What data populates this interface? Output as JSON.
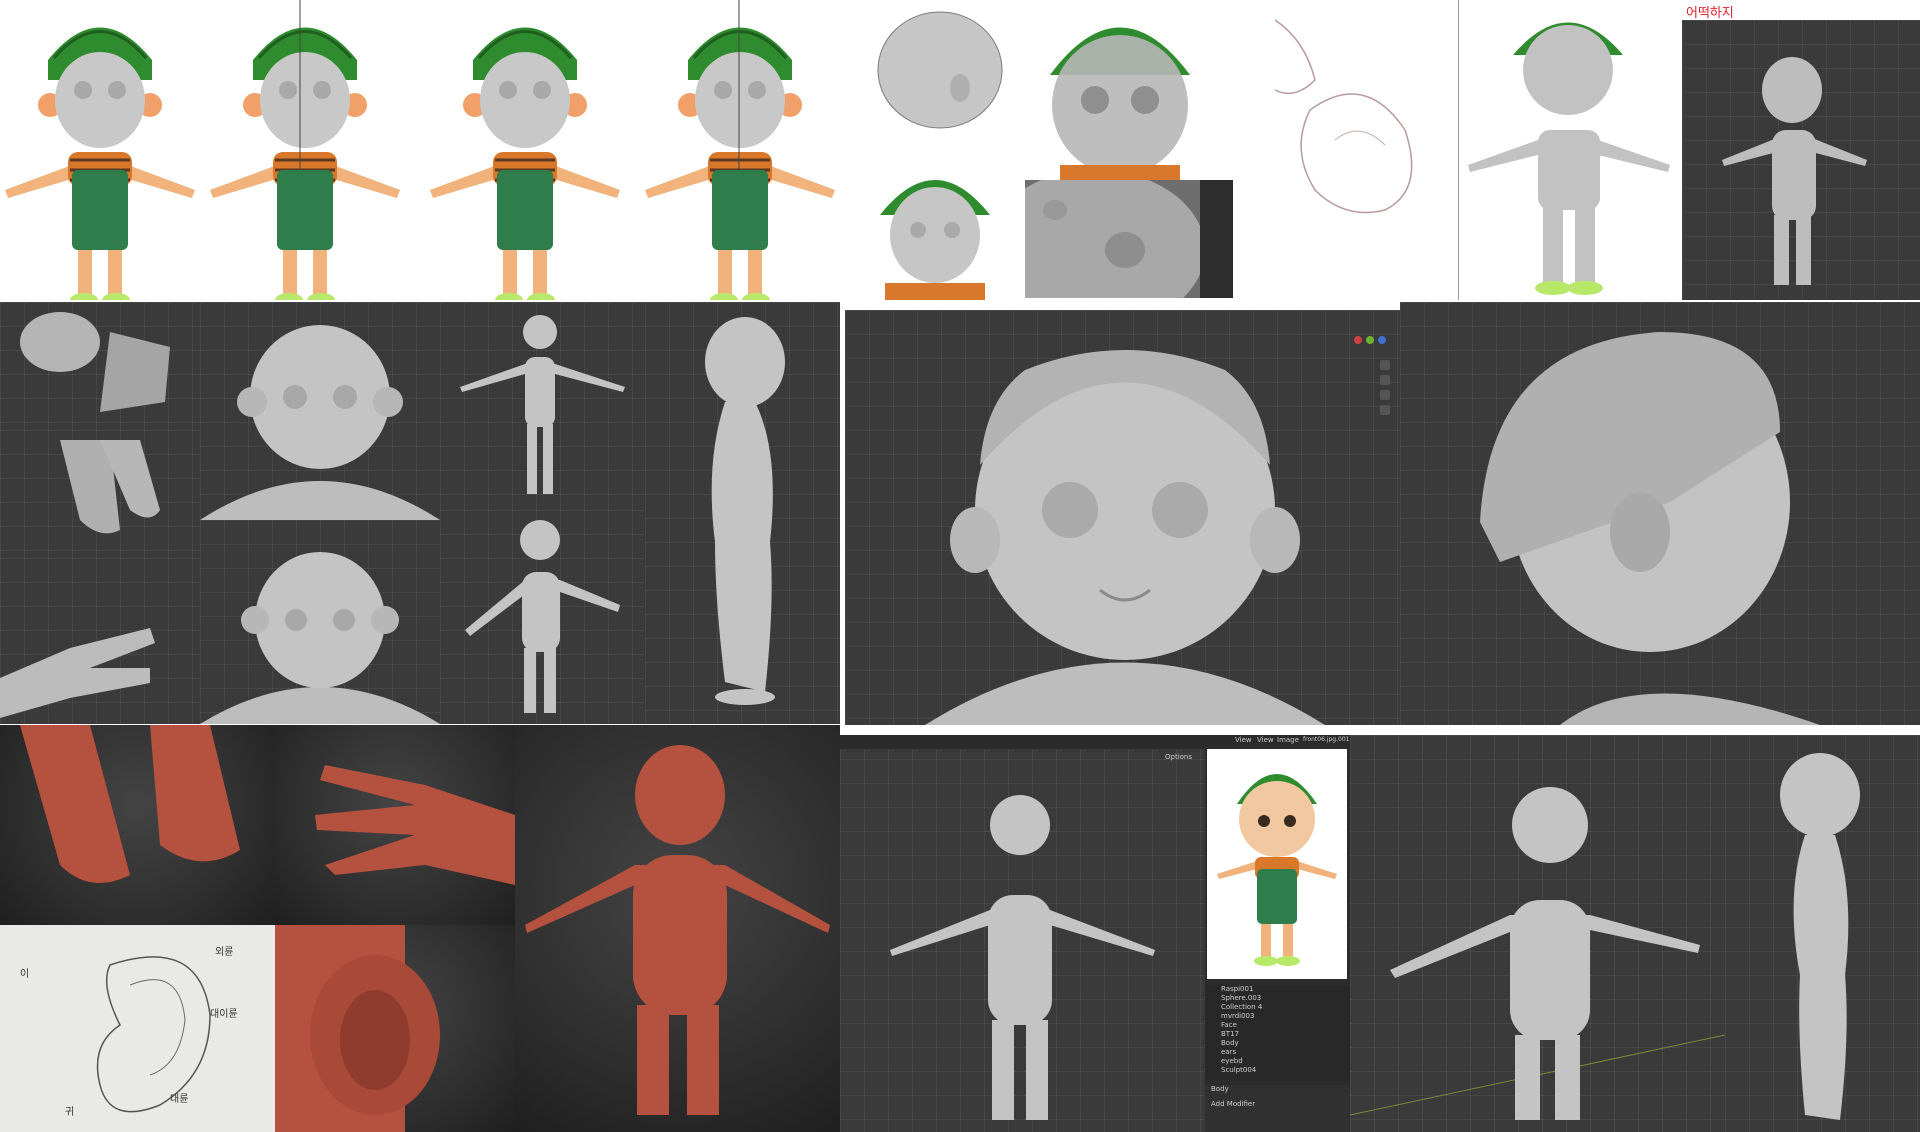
{
  "colors": {
    "sculpt_gray": "#b9b9b9",
    "clay_red": "#b5513f",
    "viewport_bg": "#3a3a3a",
    "watermelon_green": "#2e8b2e",
    "overalls_green": "#2f7d4a",
    "shirt_orange": "#d9772b",
    "skin": "#f2b27c"
  },
  "annotations": {
    "top_right_note": "어떡하지",
    "ear_sketch_label_1": "외륜",
    "ear_sketch_label_2": "대이륜",
    "ear_sketch_label_3": "대륜",
    "ear_sketch_label_4": "이",
    "ear_sketch_label_5": "귀"
  },
  "blender_ui": {
    "header_menu": [
      "View",
      "View",
      "Image"
    ],
    "image_name": "front06.jpg.001",
    "options_label": "Options",
    "outliner_rows": [
      "Raspi001",
      "Sphere.003",
      "Collection 4",
      "mvrdi003",
      "Face",
      "BT17",
      "Body",
      "ears",
      "eyebd",
      "Sculpt004"
    ],
    "properties_object": "Body",
    "add_modifier": "Add Modifier"
  },
  "panels": [
    {
      "id": "concept-front-1",
      "content": "character-concept-art"
    },
    {
      "id": "concept-front-2",
      "content": "character-concept-art"
    },
    {
      "id": "concept-front-3",
      "content": "character-concept-art"
    },
    {
      "id": "concept-front-4",
      "content": "character-concept-art"
    },
    {
      "id": "head-sculpt-side",
      "content": "head-sculpt"
    },
    {
      "id": "face-overlay",
      "content": "head-sculpt"
    },
    {
      "id": "nose-sketch",
      "content": "sketch"
    },
    {
      "id": "body-overlay",
      "content": "body-sculpt"
    },
    {
      "id": "body-3d-red-note",
      "content": "body-sculpt"
    },
    {
      "id": "feet-sculpt",
      "content": "feet-sculpt"
    },
    {
      "id": "face-bust-gray",
      "content": "head-sculpt"
    },
    {
      "id": "tpose-small",
      "content": "body-sculpt"
    },
    {
      "id": "side-body",
      "content": "body-sculpt"
    },
    {
      "id": "hair-front",
      "content": "head-sculpt"
    },
    {
      "id": "hair-side",
      "content": "head-sculpt"
    },
    {
      "id": "clay-feet",
      "content": "clay-sculpt"
    },
    {
      "id": "clay-hand",
      "content": "clay-sculpt"
    },
    {
      "id": "clay-body",
      "content": "clay-sculpt"
    },
    {
      "id": "ear-sketch",
      "content": "sketch"
    },
    {
      "id": "clay-ear",
      "content": "clay-sculpt"
    },
    {
      "id": "blender-final",
      "content": "body-sculpt"
    },
    {
      "id": "final-3q",
      "content": "body-sculpt"
    },
    {
      "id": "final-side",
      "content": "body-sculpt"
    }
  ]
}
